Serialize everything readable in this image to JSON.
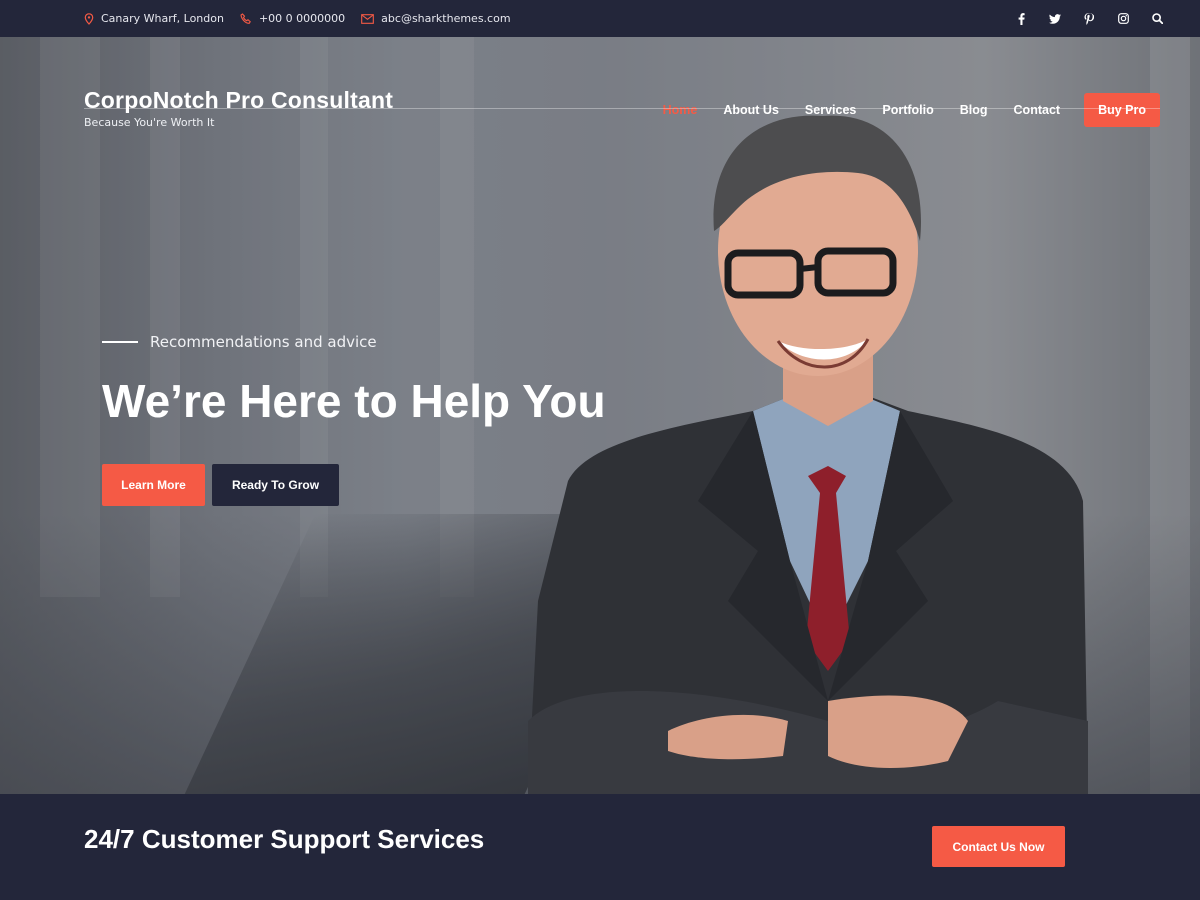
{
  "topbar": {
    "location": "Canary Wharf, London",
    "phone": "+00 0 0000000",
    "email": "abc@sharkthemes.com",
    "icons": [
      "map-pin-icon",
      "phone-icon",
      "mail-icon",
      "facebook-icon",
      "twitter-icon",
      "pinterest-icon",
      "instagram-icon",
      "search-icon"
    ]
  },
  "brand": {
    "title": "CorpoNotch Pro Consultant",
    "tagline": "Because You're Worth It"
  },
  "nav": {
    "items": [
      "Home",
      "About Us",
      "Services",
      "Portfolio",
      "Blog",
      "Contact"
    ],
    "active": "Home",
    "cta": "Buy Pro"
  },
  "hero": {
    "eyebrow": "Recommendations and advice",
    "headline": "We’re Here to Help You",
    "primary_button": "Learn More",
    "secondary_button": "Ready To Grow"
  },
  "bottom": {
    "title": "24/7 Customer Support Services",
    "button": "Contact Us Now"
  },
  "colors": {
    "accent": "#f55a45",
    "dark": "#23263a"
  }
}
